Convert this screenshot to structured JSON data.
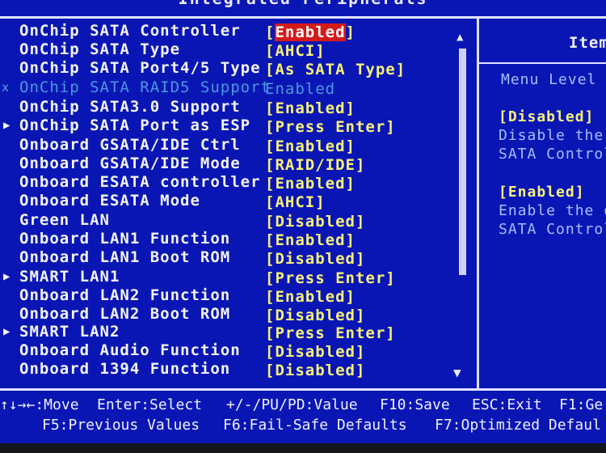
{
  "window": {
    "title": "Integrated Peripherals"
  },
  "settings": [
    {
      "label": "OnChip SATA Controller",
      "value": "[Enabled]",
      "selected": true
    },
    {
      "label": "OnChip SATA Type",
      "value": "[AHCI]"
    },
    {
      "label": "OnChip SATA Port4/5 Type",
      "value": "[As SATA Type]"
    },
    {
      "label": "OnChip SATA RAID5 Support",
      "value": "Enabled",
      "disabled": true
    },
    {
      "label": "OnChip SATA3.0 Support",
      "value": "[Enabled]"
    },
    {
      "label": "OnChip SATA Port as ESP",
      "value": "[Press Enter]",
      "submenu": true
    },
    {
      "label": "Onboard GSATA/IDE Ctrl",
      "value": "[Enabled]"
    },
    {
      "label": "Onboard GSATA/IDE Mode",
      "value": "[RAID/IDE]"
    },
    {
      "label": "Onboard ESATA controller",
      "value": "[Enabled]"
    },
    {
      "label": "Onboard ESATA Mode",
      "value": "[AHCI]"
    },
    {
      "label": "Green LAN",
      "value": "[Disabled]"
    },
    {
      "label": "Onboard LAN1 Function",
      "value": "[Enabled]"
    },
    {
      "label": "Onboard LAN1 Boot ROM",
      "value": "[Disabled]"
    },
    {
      "label": "SMART LAN1",
      "value": "[Press Enter]",
      "submenu": true
    },
    {
      "label": "Onboard LAN2 Function",
      "value": "[Enabled]"
    },
    {
      "label": "Onboard LAN2 Boot ROM",
      "value": "[Disabled]"
    },
    {
      "label": "SMART LAN2",
      "value": "[Press Enter]",
      "submenu": true
    },
    {
      "label": "Onboard Audio Function",
      "value": "[Disabled]"
    },
    {
      "label": "Onboard 1394 Function",
      "value": "[Disabled]"
    }
  ],
  "selected_value_inner": "Enabled",
  "help": {
    "title": "Item",
    "menu_level": "Menu Level",
    "lines": [
      {
        "text": "[Disabled]",
        "style": "y"
      },
      {
        "text": "Disable the",
        "style": "w"
      },
      {
        "text": "SATA Control",
        "style": "w"
      },
      {
        "text": "[Enabled]",
        "style": "y"
      },
      {
        "text": "Enable the o",
        "style": "w"
      },
      {
        "text": "SATA Control",
        "style": "w"
      }
    ]
  },
  "footer": {
    "move": "↑↓→←:Move",
    "select": "Enter:Select",
    "value": "+/-/PU/PD:Value",
    "save": "F10:Save",
    "exit": "ESC:Exit",
    "general": "F1:Ge",
    "previous": "F5:Previous Values",
    "failsafe": "F6:Fail-Safe Defaults",
    "optimized": "F7:Optimized Defaul"
  },
  "colors": {
    "background": "#0a16b4",
    "label": "#f3f3f3",
    "value": "#f7f07a",
    "highlight": "#d41a1a",
    "disabled": "#4a98df"
  },
  "icons": {
    "submenu_arrow": "▶",
    "disabled_mark": "x",
    "scroll_up": "▲",
    "scroll_down": "▼"
  }
}
